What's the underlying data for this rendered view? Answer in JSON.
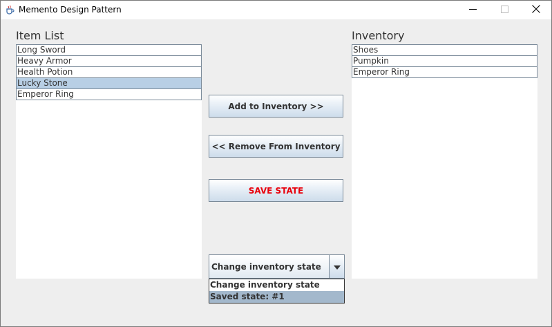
{
  "window": {
    "title": "Memento Design Pattern"
  },
  "item_list": {
    "label": "Item List",
    "items": [
      "Long Sword",
      "Heavy Armor",
      "Health Potion",
      "Lucky Stone",
      "Emperor Ring"
    ],
    "selected": "Lucky Stone"
  },
  "inventory": {
    "label": "Inventory",
    "items": [
      "Shoes",
      "Pumpkin",
      "Emperor Ring"
    ]
  },
  "buttons": {
    "add": "Add to Inventory >>",
    "remove": "<< Remove From Inventory",
    "save": "SAVE STATE"
  },
  "state_combo": {
    "value": "Change inventory state",
    "options": [
      "Change inventory state",
      "Saved state: #1"
    ],
    "highlighted": "Saved state: #1"
  },
  "colors": {
    "save_text": "#e8000b",
    "selection": "#b8cfe5",
    "popup_highlight": "#a3b8cc"
  },
  "icons": {
    "app": "java-cup-icon",
    "minimize": "minimize-icon",
    "maximize": "maximize-icon",
    "close": "close-icon",
    "dropdown": "chevron-down-icon"
  }
}
